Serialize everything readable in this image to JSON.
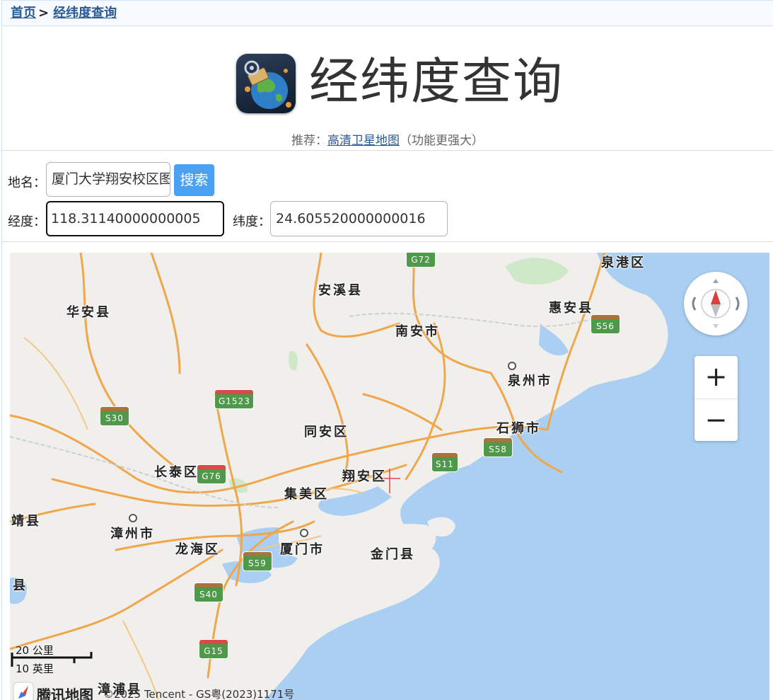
{
  "breadcrumb": {
    "home": "首页",
    "separator": ">",
    "current": "经纬度查询"
  },
  "header": {
    "title": "经纬度查询",
    "recommend_prefix": "推荐：",
    "recommend_link": "高清卫星地图",
    "recommend_suffix": "（功能更强大）"
  },
  "form": {
    "place_label": "地名：",
    "place_value": "厦门大学翔安校区图",
    "search_label": "搜索",
    "lng_label": "经度：",
    "lng_value": "118.31140000000005",
    "lat_label": "纬度：",
    "lat_value": "24.605520000000016"
  },
  "map": {
    "places": [
      "泉港区",
      "安溪县",
      "华安县",
      "惠安县",
      "南安市",
      "泉州市",
      "石狮市",
      "同安区",
      "长泰区",
      "翔安区",
      "集美区",
      "靖县",
      "漳州市",
      "龙海区",
      "厦门市",
      "金门县",
      "县",
      "漳浦县"
    ],
    "roads": [
      "G72",
      "S56",
      "G1523",
      "S30",
      "S58",
      "S11",
      "G76",
      "S59",
      "S40",
      "G15"
    ],
    "zoom_in": "+",
    "zoom_out": "−",
    "scale_km": "20 公里",
    "scale_mi": "10 英里",
    "logo": "腾讯地图",
    "copyright": "©2025 Tencent - GS粤(2023)1171号"
  },
  "colors": {
    "link": "#2a5a95",
    "button": "#4aa0f2",
    "sea": "#aacff3",
    "land": "#f0efec",
    "highway": "#f0a64a"
  }
}
